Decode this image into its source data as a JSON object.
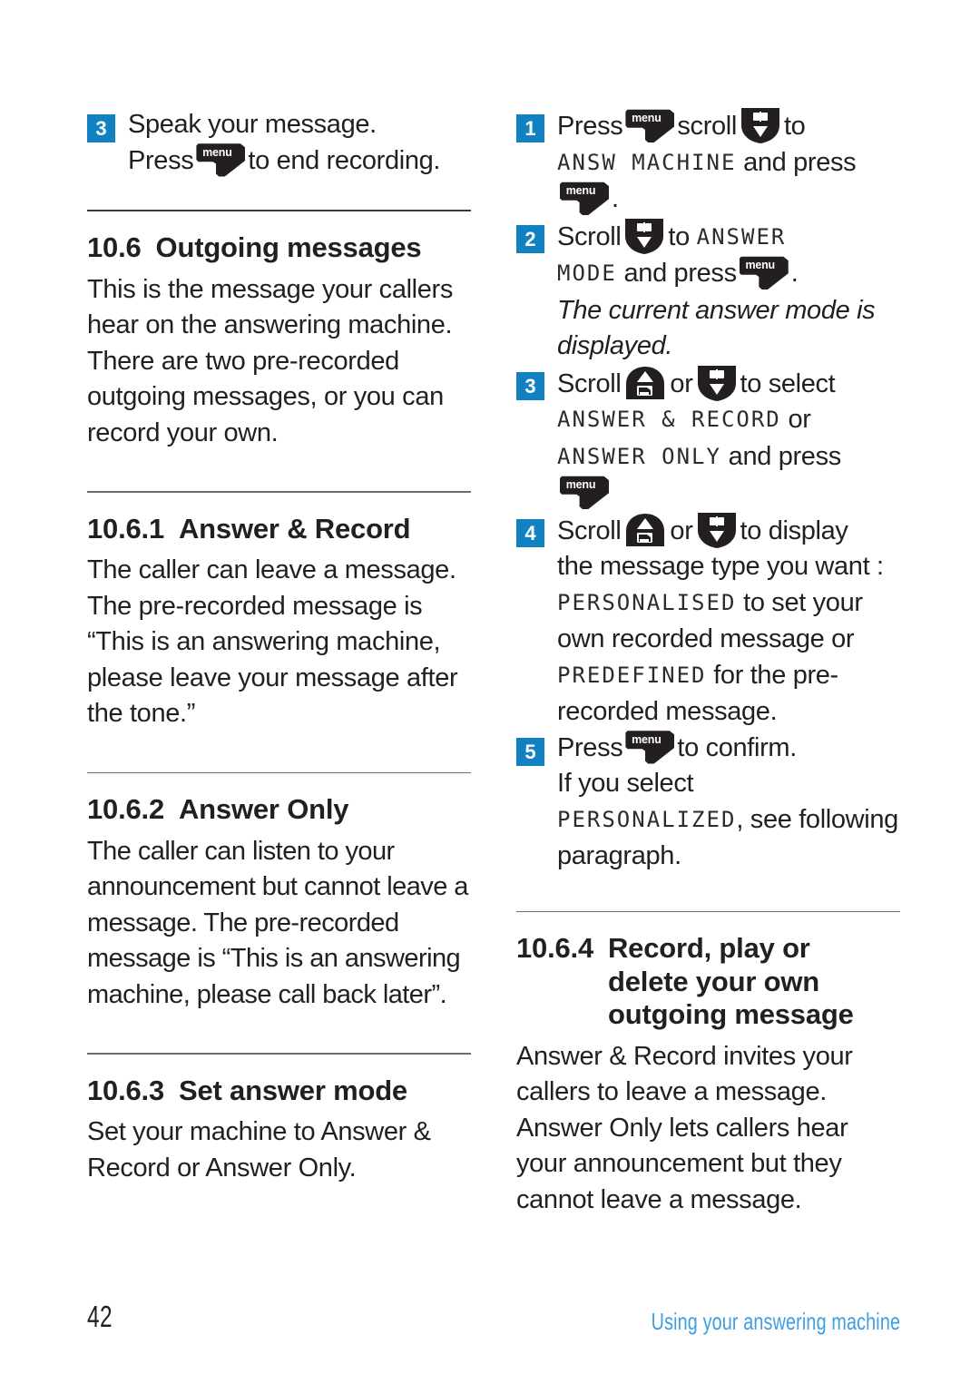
{
  "page": {
    "number": "42",
    "footer_title": "Using your answering machine"
  },
  "icons": {
    "menu_label": "menu",
    "menu_name": "menu-key-icon",
    "scroll_up_name": "scroll-up-key-icon",
    "scroll_down_name": "scroll-down-key-icon"
  },
  "colors": {
    "badge_blue": "#1281c2",
    "footer_blue": "#3f9ee0",
    "ink": "#231f20"
  },
  "left_column": {
    "step3": {
      "num": "3",
      "line1": "Speak your message.",
      "line2_pre": "Press",
      "line2_post": "to end recording."
    },
    "section_10_6": {
      "num": "10.6",
      "title": "Outgoing messages",
      "body": "This is the message your callers hear on the answering machine. There are two pre-recorded outgoing messages, or you can record your own."
    },
    "section_10_6_1": {
      "num": "10.6.1",
      "title": "Answer & Record",
      "body": "The caller can leave a message. The pre-recorded message is “This is an answering machine, please leave your message after the tone.”"
    },
    "section_10_6_2": {
      "num": "10.6.2",
      "title": "Answer Only",
      "body": "The caller can listen to your announcement but cannot leave a message. The pre-recorded message is “This is an answering machine, please call back later”."
    },
    "section_10_6_3": {
      "num": "10.6.3",
      "title": "Set answer mode",
      "body": "Set your machine to Answer & Record or Answer Only."
    }
  },
  "right_column": {
    "step1": {
      "num": "1",
      "t1": "Press",
      "t2": "scroll",
      "t3": "to",
      "lcd1": "ANSW MACHINE",
      "t4": "and press",
      "t5": "."
    },
    "step2": {
      "num": "2",
      "t1": "Scroll",
      "t2": "to",
      "lcd1": "ANSWER",
      "lcd2": "MODE",
      "t3": "and press",
      "t4": ".",
      "note": "The current answer mode is displayed."
    },
    "step3": {
      "num": "3",
      "t1": "Scroll",
      "t2": "or",
      "t3": "to select",
      "lcd1": "ANSWER & RECORD",
      "t4": "or",
      "lcd2": "ANSWER ONLY",
      "t5": "and press"
    },
    "step4": {
      "num": "4",
      "t1": "Scroll",
      "t2": "or",
      "t3": "to display",
      "t4": "the message type you want :",
      "lcd1": "PERSONALISED",
      "t5": "to set your own recorded message or",
      "lcd2": "PREDEFINED",
      "t6": "for the pre-recorded message."
    },
    "step5": {
      "num": "5",
      "t1": "Press",
      "t2": "to confirm.",
      "t3": "If you select",
      "lcd1": "PERSONALIZED",
      "t4": ", see following paragraph."
    },
    "section_10_6_4": {
      "num": "10.6.4",
      "title_line1": "Record, play or",
      "title_line2": "delete your own",
      "title_line3": "outgoing message",
      "body": "Answer & Record invites your callers to leave a message. Answer Only lets callers hear your announcement but they cannot leave a message."
    }
  }
}
